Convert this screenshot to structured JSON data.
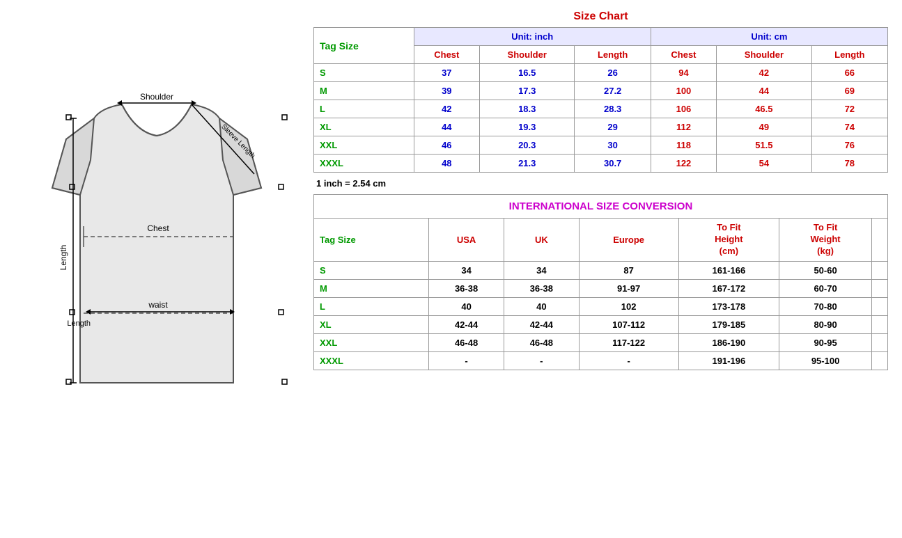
{
  "title": "Size Chart",
  "size_chart": {
    "unit_inch": "Unit: inch",
    "unit_cm": "Unit: cm",
    "tag_size_label": "Tag Size",
    "headers_inch": [
      "Chest",
      "Shoulder",
      "Length"
    ],
    "headers_cm": [
      "Chest",
      "Shoulder",
      "Length"
    ],
    "rows": [
      {
        "tag": "S",
        "inch_chest": "37",
        "inch_shoulder": "16.5",
        "inch_length": "26",
        "cm_chest": "94",
        "cm_shoulder": "42",
        "cm_length": "66"
      },
      {
        "tag": "M",
        "inch_chest": "39",
        "inch_shoulder": "17.3",
        "inch_length": "27.2",
        "cm_chest": "100",
        "cm_shoulder": "44",
        "cm_length": "69"
      },
      {
        "tag": "L",
        "inch_chest": "42",
        "inch_shoulder": "18.3",
        "inch_length": "28.3",
        "cm_chest": "106",
        "cm_shoulder": "46.5",
        "cm_length": "72"
      },
      {
        "tag": "XL",
        "inch_chest": "44",
        "inch_shoulder": "19.3",
        "inch_length": "29",
        "cm_chest": "112",
        "cm_shoulder": "49",
        "cm_length": "74"
      },
      {
        "tag": "XXL",
        "inch_chest": "46",
        "inch_shoulder": "20.3",
        "inch_length": "30",
        "cm_chest": "118",
        "cm_shoulder": "51.5",
        "cm_length": "76"
      },
      {
        "tag": "XXXL",
        "inch_chest": "48",
        "inch_shoulder": "21.3",
        "inch_length": "30.7",
        "cm_chest": "122",
        "cm_shoulder": "54",
        "cm_length": "78"
      }
    ],
    "conversion_note": "1 inch = 2.54 cm"
  },
  "intl_conversion": {
    "title": "INTERNATIONAL SIZE CONVERSION",
    "tag_size_label": "Tag Size",
    "headers": [
      "USA",
      "UK",
      "Europe",
      "To Fit\nHeight\n(cm)",
      "To Fit\nWeight\n(kg)"
    ],
    "header_usa": "USA",
    "header_uk": "UK",
    "header_europe": "Europe",
    "header_height": "To Fit Height (cm)",
    "header_weight": "To Fit Weight (kg)",
    "rows": [
      {
        "tag": "S",
        "usa": "34",
        "uk": "34",
        "europe": "87",
        "height": "161-166",
        "weight": "50-60"
      },
      {
        "tag": "M",
        "usa": "36-38",
        "uk": "36-38",
        "europe": "91-97",
        "height": "167-172",
        "weight": "60-70"
      },
      {
        "tag": "L",
        "usa": "40",
        "uk": "40",
        "europe": "102",
        "height": "173-178",
        "weight": "70-80"
      },
      {
        "tag": "XL",
        "usa": "42-44",
        "uk": "42-44",
        "europe": "107-112",
        "height": "179-185",
        "weight": "80-90"
      },
      {
        "tag": "XXL",
        "usa": "46-48",
        "uk": "46-48",
        "europe": "117-122",
        "height": "186-190",
        "weight": "90-95"
      },
      {
        "tag": "XXXL",
        "usa": "-",
        "uk": "-",
        "europe": "-",
        "height": "191-196",
        "weight": "95-100"
      }
    ]
  },
  "diagram": {
    "shoulder_label": "Shoulder",
    "chest_label": "Chest",
    "length_label": "Length",
    "waist_label": "waist",
    "sleeve_label": "Sleeve Length"
  }
}
